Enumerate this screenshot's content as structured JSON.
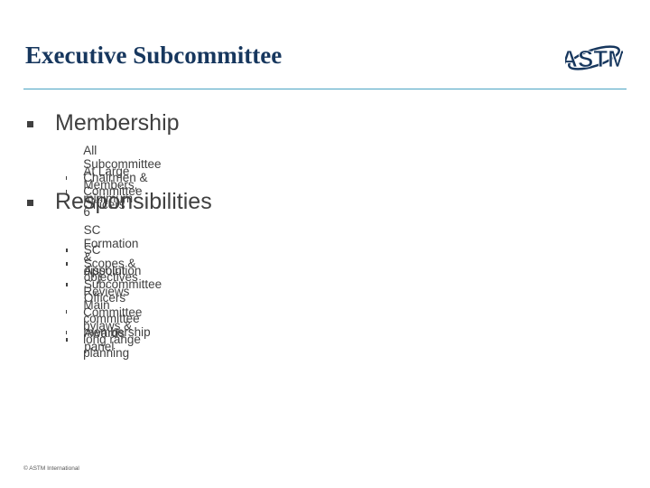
{
  "slide": {
    "title": "Executive Subcommittee",
    "logo_label": "ASTM",
    "sections": [
      {
        "heading": "Membership",
        "items": [
          "All Subcommittee Chairmen & Committee Officers",
          "At Large Members, minimum 6"
        ]
      },
      {
        "heading": "Responsibilities",
        "items": [
          "SC Formation & dissolution",
          "SC Scopes & objectives",
          "Appoint Subcommittee Officers",
          "Reviews Main committee membership",
          "Committee bylaws & long range planning",
          "Awards panel"
        ]
      }
    ],
    "footer": "© ASTM International",
    "colors": {
      "title": "#17375e",
      "rule": "#4aa3c3",
      "text": "#404040"
    }
  }
}
